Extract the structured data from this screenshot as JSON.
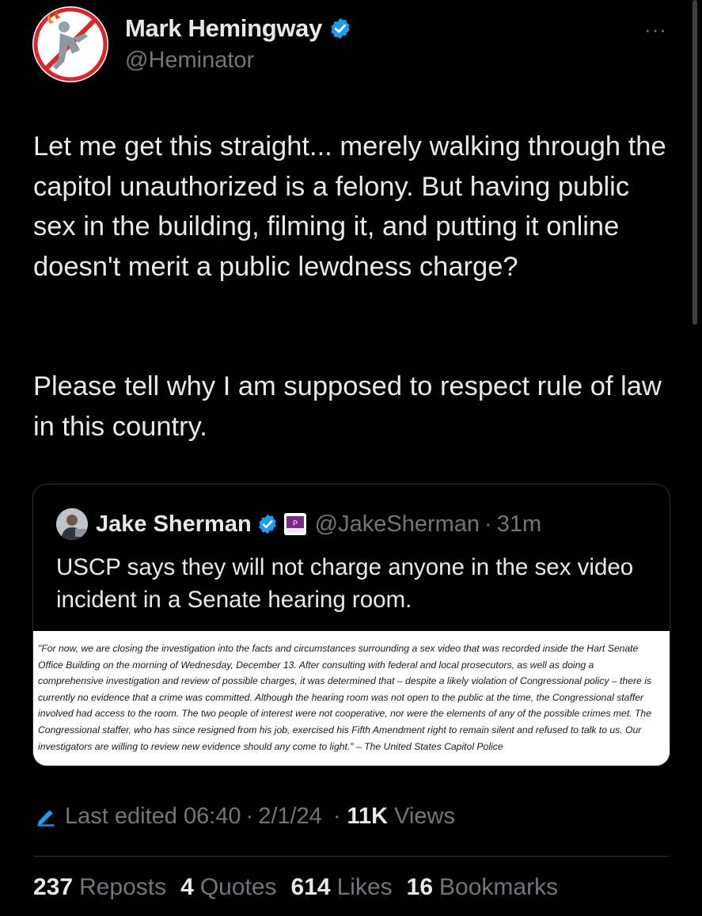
{
  "author": {
    "name": "Mark Hemingway",
    "handle": "@Heminator",
    "verified_color": "#1d9bf0"
  },
  "tweet": {
    "paragraph_1": "Let me get this straight... merely walking through the capitol unauthorized is a felony. But having public sex in the building, filming it, and putting it online doesn't merit a public lewdness charge?",
    "paragraph_2": "Please tell why I am supposed to respect rule of law in this country."
  },
  "quoted_tweet": {
    "name": "Jake Sherman",
    "handle": "@JakeSherman",
    "separator": "·",
    "time": "31m",
    "text": "USCP says they will not charge anyone in the sex video incident in a Senate hearing room.",
    "image_text": "\"For now, we are closing the investigation into the facts and circumstances surrounding a sex video that was recorded inside the Hart Senate Office Building on the morning of Wednesday, December 13. After consulting with federal and local prosecutors, as well as doing a comprehensive investigation and review of possible charges, it was determined that – despite a likely violation of Congressional policy – there is currently no evidence that a crime was committed. Although the hearing room was not open to the public at the time, the Congressional staffer involved had access to the room. The two people of interest were not cooperative, nor were the elements of any of the possible crimes met. The Congressional staffer, who has since resigned from his job, exercised his Fifth Amendment right to remain silent and refused to talk to us. Our investigators are willing to review new evidence should any come to light.\" – The United States Capitol Police"
  },
  "meta": {
    "edited_label": "Last edited 06:40",
    "separator": "·",
    "date": "2/1/24",
    "views_count": "11K",
    "views_label": "Views"
  },
  "stats": {
    "reposts_count": "237",
    "reposts_label": "Reposts",
    "quotes_count": "4",
    "quotes_label": "Quotes",
    "likes_count": "614",
    "likes_label": "Likes",
    "bookmarks_count": "16",
    "bookmarks_label": "Bookmarks"
  },
  "more_icon": "···"
}
